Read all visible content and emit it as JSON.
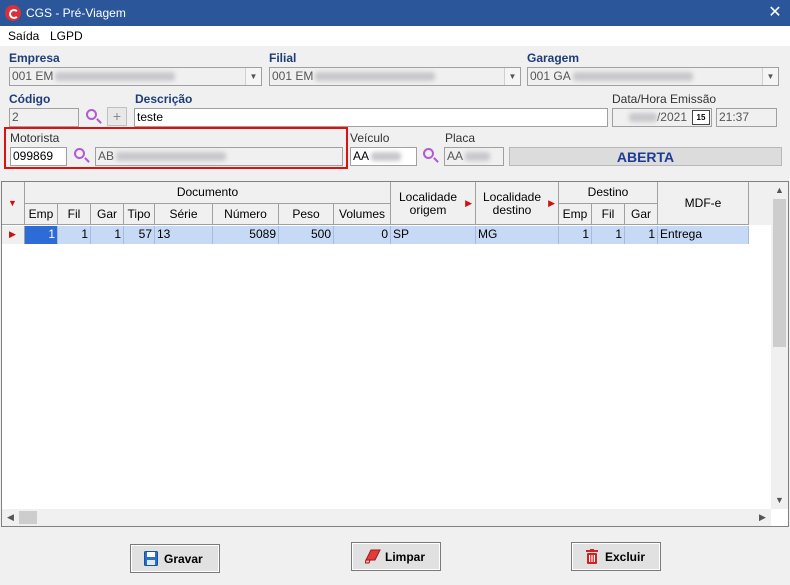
{
  "window": {
    "title": "CGS - Pré-Viagem",
    "close": "✕"
  },
  "menu": [
    "Saída",
    "LGPD"
  ],
  "form": {
    "empresa": {
      "label": "Empresa",
      "value": "001 EM"
    },
    "filial": {
      "label": "Filial",
      "value": "001 EM"
    },
    "garagem": {
      "label": "Garagem",
      "value": "001 GA"
    },
    "codigo": {
      "label": "Código",
      "value": "2"
    },
    "descricao": {
      "label": "Descrição",
      "value": "teste"
    },
    "emissao": {
      "label": "Data/Hora Emissão",
      "date": "/2021",
      "time": "21:37",
      "cal": "15"
    },
    "motorista": {
      "label": "Motorista",
      "code": "099869",
      "name": "AB"
    },
    "veiculo": {
      "label": "Veículo",
      "value": "AA"
    },
    "placa": {
      "label": "Placa",
      "value": "AA"
    },
    "status": "ABERTA"
  },
  "grid": {
    "groups": {
      "documento": "Documento",
      "localidade_origem": "Localidade origem",
      "localidade_destino": "Localidade destino",
      "destino": "Destino",
      "mdfe": "MDF-e"
    },
    "columns": [
      "Emp",
      "Fil",
      "Gar",
      "Tipo",
      "Série",
      "Número",
      "Peso",
      "Volumes"
    ],
    "dest_columns": [
      "Emp",
      "Fil",
      "Gar"
    ],
    "rows": [
      {
        "emp": "1",
        "fil": "1",
        "gar": "1",
        "tipo": "57",
        "serie": "13",
        "numero": "5089",
        "peso": "500",
        "volumes": "0",
        "origem": "SP",
        "destino": "MG",
        "d_emp": "1",
        "d_fil": "1",
        "d_gar": "1",
        "mdfe": "Entrega"
      }
    ]
  },
  "buttons": {
    "gravar": "Gravar",
    "limpar": "Limpar",
    "excluir": "Excluir"
  },
  "colors": {
    "titlebar": "#2b579a",
    "row_selected": "#c6d9f5",
    "highlight_border": "#e01010",
    "status_text": "#1e3c96"
  }
}
